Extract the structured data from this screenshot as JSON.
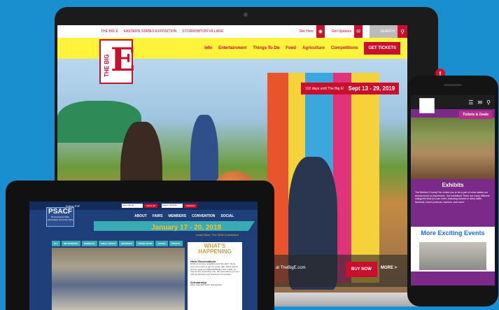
{
  "laptop": {
    "topbar": {
      "links": [
        "THE BIG E",
        "EASTERN STATES EXPOSITION",
        "STORROWTON VILLAGE"
      ],
      "get_here": "Get Here",
      "get_updates": "Get Updates",
      "search_placeholder": "SEARCH"
    },
    "nav": {
      "items": [
        "Info",
        "Entertainment",
        "Things To Do",
        "Food",
        "Agriculture",
        "Competitions"
      ],
      "cta": "GET TICKETS"
    },
    "logo": {
      "small": "THE BIG",
      "letter": "E"
    },
    "countdown": {
      "days": "162 days until The Big E!",
      "dates": "Sept 13 - 29, 2019"
    },
    "banner": {
      "url": "at TheBigE.com",
      "buy": "BUY NOW",
      "more": "MORE >"
    },
    "social": {
      "facebook": "f"
    }
  },
  "tablet": {
    "topbar": {
      "follow": "Follow PSF",
      "email_placeholder": "Enter Email",
      "signup": "SIGN UP",
      "search_placeholder": "Search Website",
      "search_btn": "SEARCH"
    },
    "logo": {
      "title": "PSACF",
      "subtitle": "Pennsylvania State Association of County Fairs"
    },
    "nav": [
      "ABOUT",
      "FAIRS",
      "MEMBERS",
      "CONVENTION",
      "SOCIAL"
    ],
    "date": "January 17 - 20, 2018",
    "sub": "Learn More: The 2018 Convention",
    "tabs": [
      "ALL",
      "NETWORKING",
      "SEMINARS",
      "TABLE TOPICS",
      "MEETINGS",
      "TRADE SHOW",
      "SOCIAL",
      "SPECIAL"
    ],
    "aside": {
      "heading": "WHAT'S HAPPENING",
      "item1_title": "Hotel Reservations",
      "item1_text": "2018 Convention available April 3rd, 2017. Book your room early to get our group rate. Reservations can be made at 1-800-HERSHEY (437-7439). To reserve the convention rate, tell reservations you are with the PA Fairs and Showmen Convention.",
      "item2_title": "Scholarship",
      "item2_text": "Msgr. Hilgnal/PSACF Scholarship."
    }
  },
  "phone": {
    "deals": "Tickets & Deals",
    "exhibits_title": "Exhibits",
    "exhibits_text": "The Bedford County Fair invites you to be a part of what makes our annual event so impressive - the exhibitors! There are many different categories that you can enter, including classes in dairy cattle, livestock, home products, equines, and more!",
    "more": "More Exciting Events"
  }
}
